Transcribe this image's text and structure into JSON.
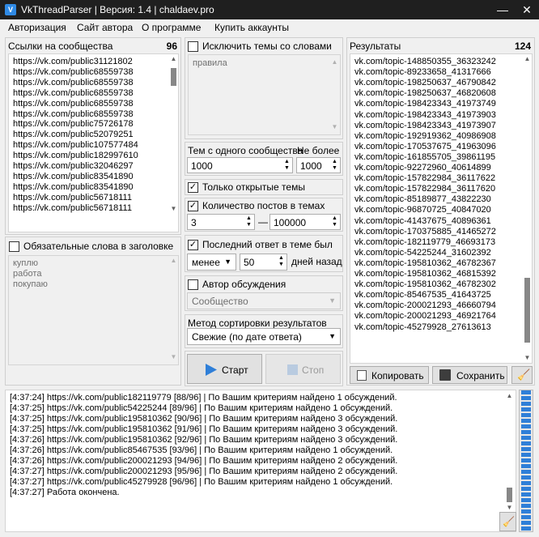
{
  "window": {
    "title": "VkThreadParser | Версия: 1.4 | chaldaev.pro",
    "minimize": "—",
    "maximize": "☐",
    "close": "✕"
  },
  "menu": [
    "Авторизация",
    "Сайт автора",
    "О программе",
    "Купить аккаунты"
  ],
  "links": {
    "header": "Ссылки на сообщества",
    "count": "96",
    "items": [
      "https://vk.com/public31121802",
      "https://vk.com/public68559738",
      "https://vk.com/public68559738",
      "https://vk.com/public68559738",
      "https://vk.com/public68559738",
      "https://vk.com/public68559738",
      "https://vk.com/public75726178",
      "https://vk.com/public52079251",
      "https://vk.com/public107577484",
      "https://vk.com/public182997610",
      "https://vk.com/public32046297",
      "https://vk.com/public83541890",
      "https://vk.com/public83541890",
      "https://vk.com/public56718111",
      "https://vk.com/public56718111"
    ]
  },
  "keywords": {
    "checkbox_label": "Обязательные слова в заголовке",
    "checked": false,
    "items": [
      "куплю",
      "работа",
      "покупаю"
    ]
  },
  "exclude": {
    "checkbox_label": "Исключить темы со словами",
    "checked": false,
    "placeholder": "правила"
  },
  "per_group": {
    "label": "Тем с одного сообщества",
    "value": "1000"
  },
  "max": {
    "label": "Не более",
    "value": "1000"
  },
  "only_open": {
    "label": "Только открытые темы",
    "checked": true
  },
  "post_count": {
    "label": "Количество постов в темах",
    "checked": true,
    "from": "3",
    "dash": "—",
    "to": "100000"
  },
  "last_reply": {
    "label": "Последний ответ в теме был",
    "checked": true,
    "mode": "менее",
    "days": "50",
    "suffix": "дней назад"
  },
  "author": {
    "label": "Автор обсуждения",
    "checked": false,
    "value": "Сообщество"
  },
  "sort": {
    "label": "Метод сортировки результатов",
    "value": "Свежие (по дате ответа)"
  },
  "buttons": {
    "start": "Старт",
    "stop": "Стоп",
    "copy": "Копировать",
    "save": "Сохранить"
  },
  "results": {
    "header": "Результаты",
    "count": "124",
    "items": [
      "vk.com/topic-148850355_36323242",
      "vk.com/topic-89233658_41317666",
      "vk.com/topic-198250637_46790842",
      "vk.com/topic-198250637_46820608",
      "vk.com/topic-198423343_41973749",
      "vk.com/topic-198423343_41973903",
      "vk.com/topic-198423343_41973907",
      "vk.com/topic-192919362_40986908",
      "vk.com/topic-170537675_41963096",
      "vk.com/topic-161855705_39861195",
      "vk.com/topic-92272960_40614899",
      "vk.com/topic-157822984_36117622",
      "vk.com/topic-157822984_36117620",
      "vk.com/topic-85189877_43822230",
      "vk.com/topic-96870725_40847020",
      "vk.com/topic-41437675_40896361",
      "vk.com/topic-170375885_41465272",
      "vk.com/topic-182119779_46693173",
      "vk.com/topic-54225244_31602392",
      "vk.com/topic-195810362_46782367",
      "vk.com/topic-195810362_46815392",
      "vk.com/topic-195810362_46782302",
      "vk.com/topic-85467535_41643725",
      "vk.com/topic-200021293_46660794",
      "vk.com/topic-200021293_46921764",
      "vk.com/topic-45279928_27613613"
    ]
  },
  "log": [
    "[4:37:24] https://vk.com/public182119779 [88/96] | По Вашим критериям найдено 1 обсуждений.",
    "[4:37:25] https://vk.com/public54225244 [89/96] | По Вашим критериям найдено 1 обсуждений.",
    "[4:37:25] https://vk.com/public195810362 [90/96] | По Вашим критериям найдено 3 обсуждений.",
    "[4:37:25] https://vk.com/public195810362 [91/96] | По Вашим критериям найдено 3 обсуждений.",
    "[4:37:26] https://vk.com/public195810362 [92/96] | По Вашим критериям найдено 3 обсуждений.",
    "[4:37:26] https://vk.com/public85467535 [93/96] | По Вашим критериям найдено 1 обсуждений.",
    "[4:37:26] https://vk.com/public200021293 [94/96] | По Вашим критериям найдено 2 обсуждений.",
    "[4:37:27] https://vk.com/public200021293 [95/96] | По Вашим критериям найдено 2 обсуждений.",
    "[4:37:27] https://vk.com/public45279928 [96/96] | По Вашим критериям найдено 1 обсуждений.",
    "[4:37:27] Работа окончена."
  ],
  "progress": {
    "fraction": 1.0
  },
  "colors": {
    "accent": "#2f7fd8",
    "progress": "#2f7fd8",
    "titlebar": "#1f1f1f"
  },
  "icons": {
    "start": "play-icon",
    "stop": "stop-icon",
    "copy": "copy-icon",
    "save": "floppy-icon",
    "clear": "broom-icon"
  }
}
